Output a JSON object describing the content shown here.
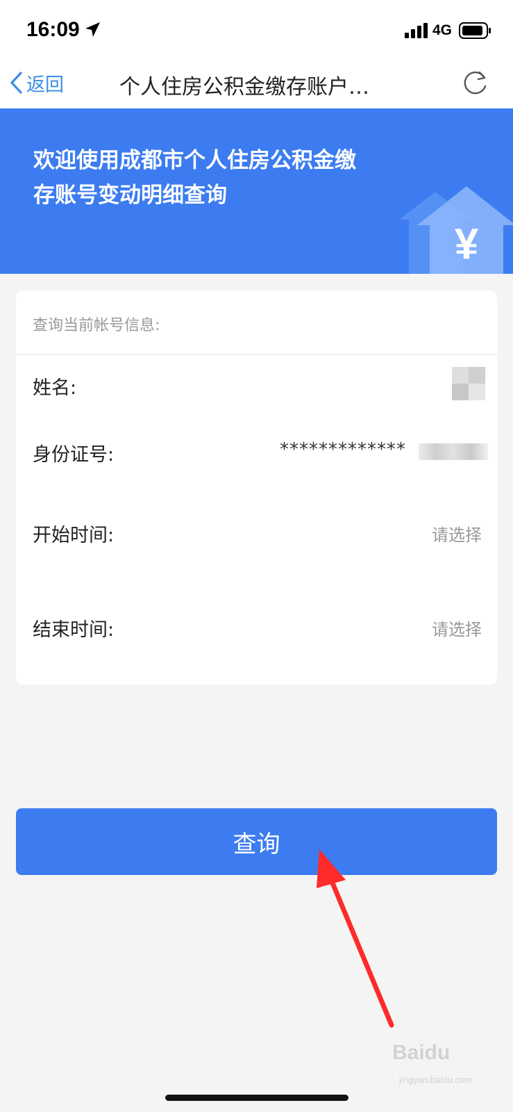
{
  "status_bar": {
    "time": "16:09",
    "network": "4G",
    "icons": [
      "location-arrow-icon",
      "signal-icon",
      "battery-icon"
    ]
  },
  "nav": {
    "back_label": "返回",
    "title": "个人住房公积金缴存账户…",
    "icons": [
      "chevron-left-icon",
      "refresh-icon"
    ],
    "accent_color": "#3a8ee6"
  },
  "banner": {
    "line1": "欢迎使用成都市个人住房公积金缴",
    "line2": "存账号变动明细查询",
    "currency_symbol": "¥",
    "background_color": "#3c7cf0"
  },
  "card": {
    "header": "查询当前帐号信息:",
    "rows": [
      {
        "label": "姓名:"
      },
      {
        "label": "身份证号:",
        "value": "*************"
      },
      {
        "label": "开始时间:",
        "value": "请选择"
      },
      {
        "label": "结束时间:",
        "value": "请选择"
      }
    ]
  },
  "query_button": {
    "label": "查询",
    "color": "#3c7cf0"
  },
  "watermark": {
    "brand": "Baidu",
    "sub": "jingyan.baidu.com"
  }
}
